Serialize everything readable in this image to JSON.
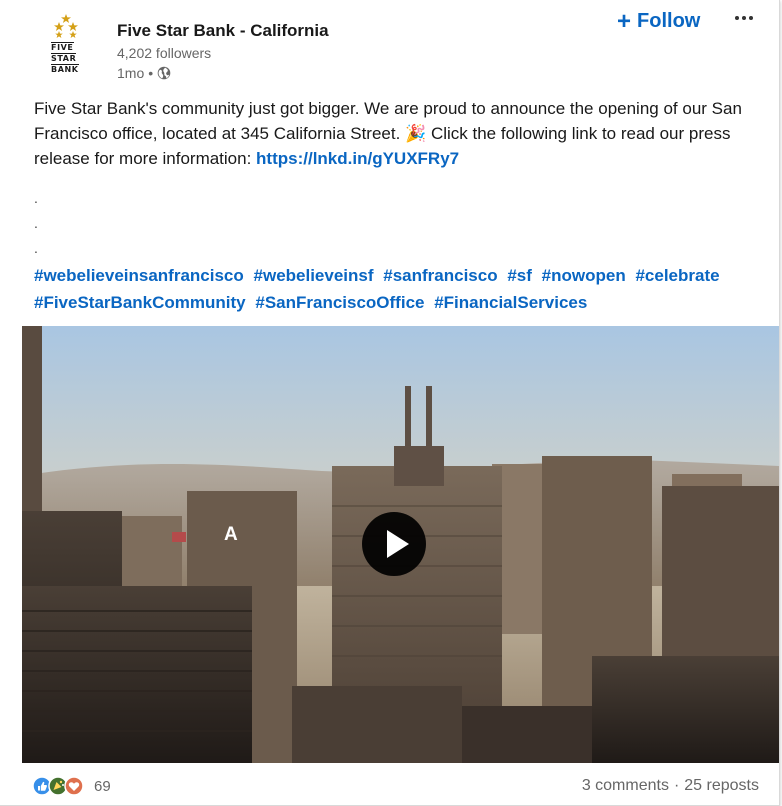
{
  "post": {
    "author": {
      "name": "Five Star Bank - California",
      "followers": "4,202 followers",
      "time": "1mo",
      "separator": "•",
      "logo_words": [
        "FIVE",
        "STAR",
        "BANK"
      ]
    },
    "follow_label": "Follow",
    "follow_plus": "+",
    "text_intro": "Five Star Bank's community just got bigger. We are proud to announce the opening of our San Francisco office, located at 345 California Street. ",
    "text_emoji": "🎉",
    "text_after": " Click the following link to read our press release for more information: ",
    "link": "https://lnkd.in/gYUXFRy7",
    "dots": [
      ".",
      ".",
      "."
    ],
    "hashtags": [
      "#webelieveinsanfrancisco",
      "#webelieveinsf",
      "#sanfrancisco",
      "#sf",
      "#nowopen",
      "#celebrate",
      "#FiveStarBankCommunity",
      "#SanFranciscoOffice",
      "#FinancialServices"
    ],
    "video": {
      "overlay_letter": "A"
    },
    "reactions": {
      "count": "69",
      "icons": [
        "like-icon",
        "celebrate-icon",
        "love-icon"
      ]
    },
    "stats": {
      "comments": "3 comments",
      "separator": "·",
      "reposts": "25 reposts"
    }
  },
  "colors": {
    "link_blue": "#0a66c2",
    "text_dark": "#191919",
    "text_muted": "#666666",
    "gold_star": "#d4a017"
  }
}
